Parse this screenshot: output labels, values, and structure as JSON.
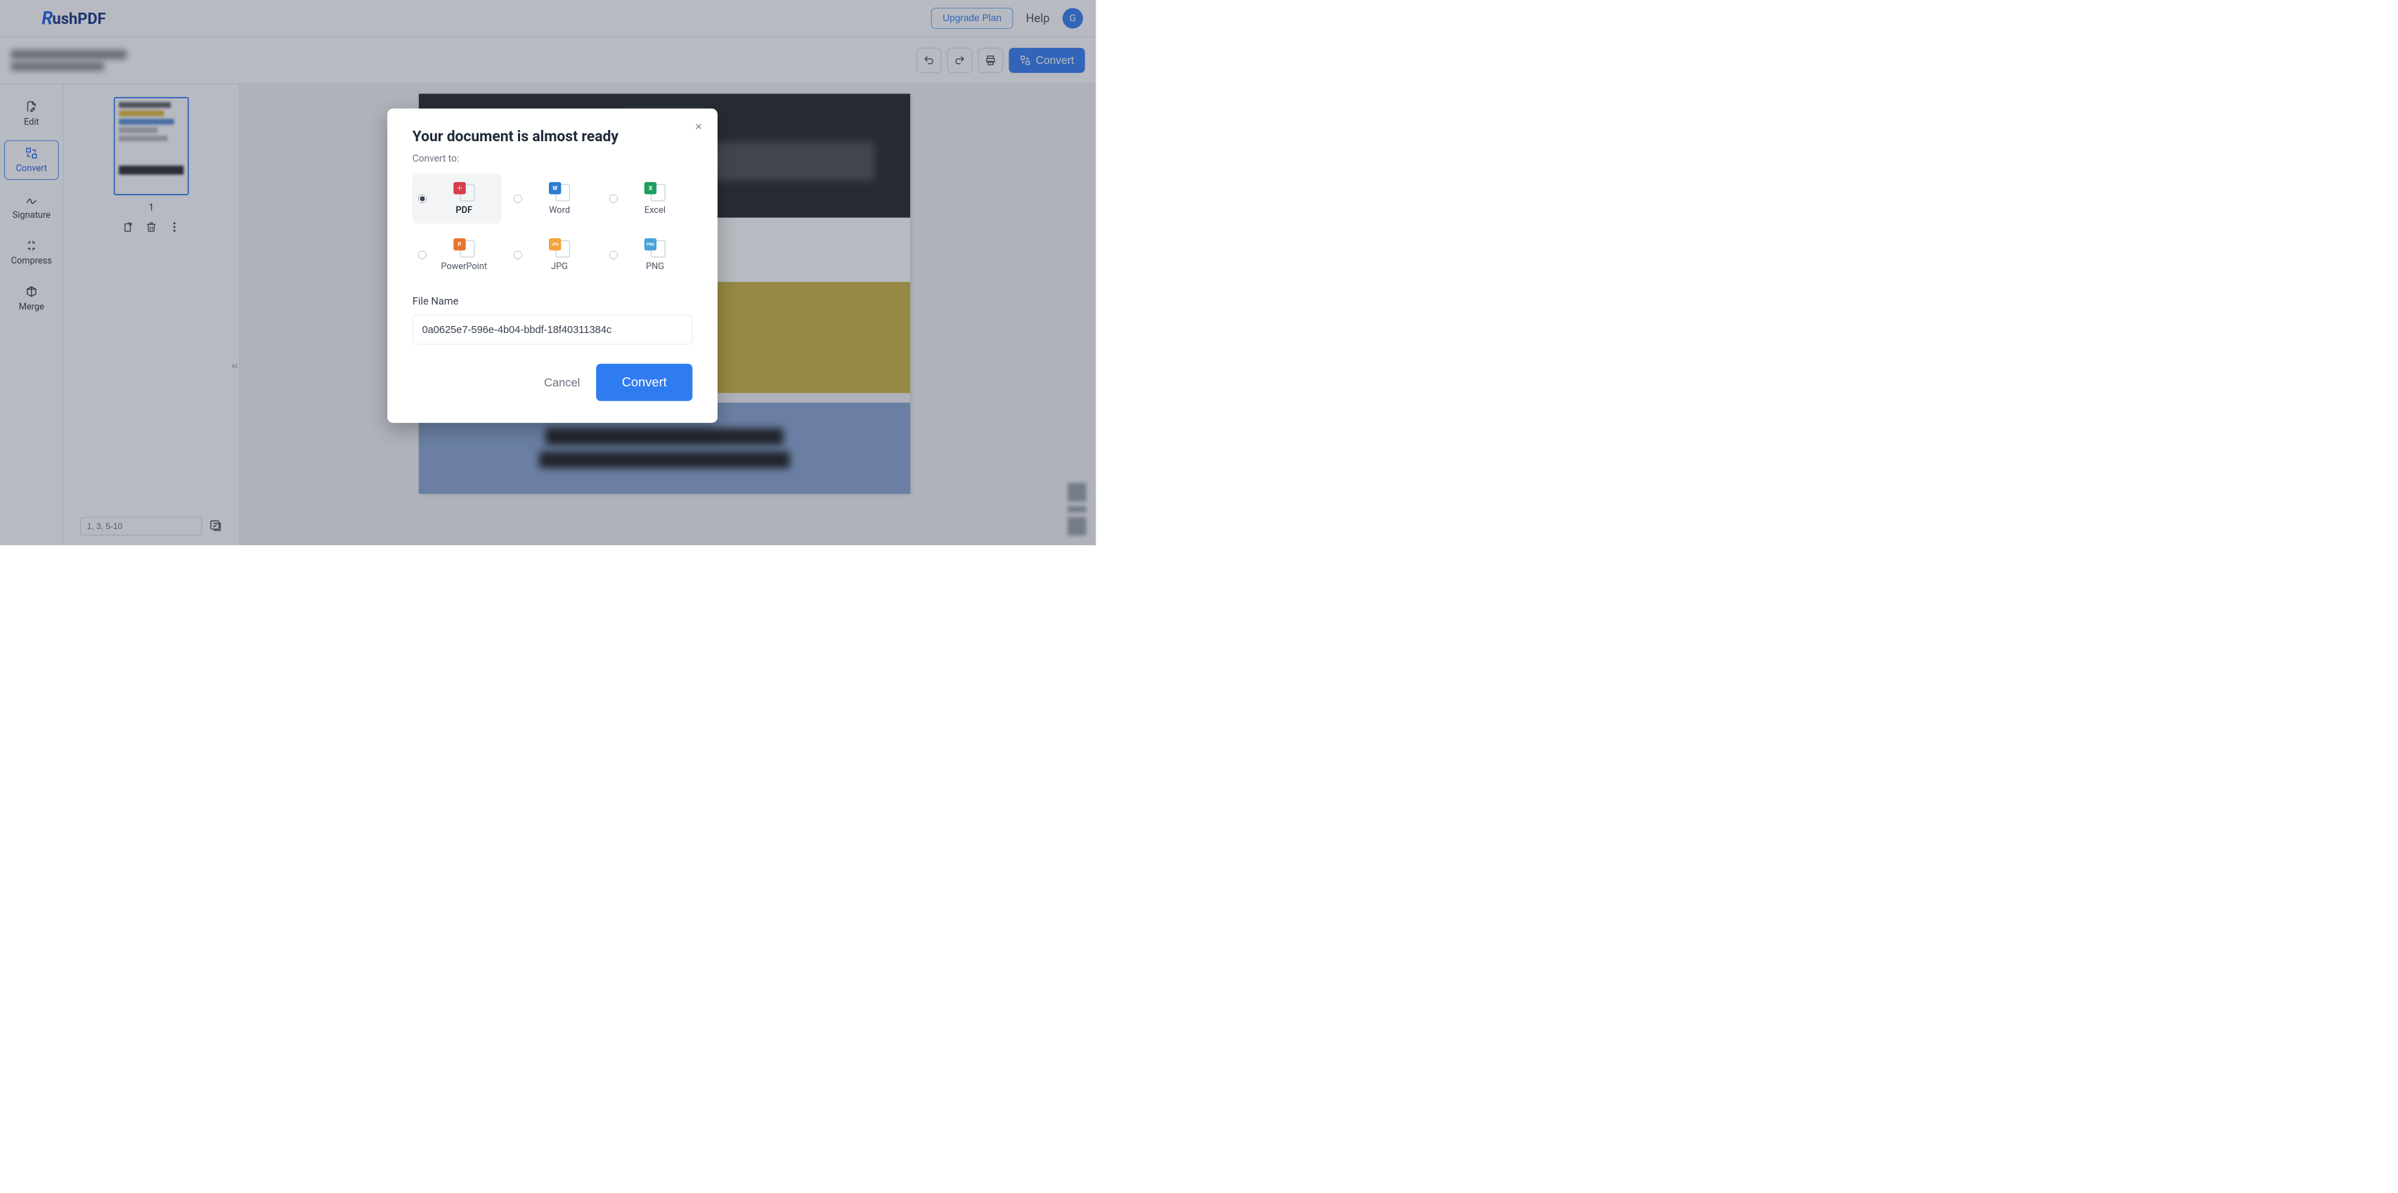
{
  "topbar": {
    "brand_part1": "R",
    "brand_part2": "ushPDF",
    "upgrade_label": "Upgrade Plan",
    "help_label": "Help",
    "avatar_initial": "G"
  },
  "toolbar": {
    "convert_label": "Convert"
  },
  "sidebar": {
    "items": [
      {
        "id": "edit",
        "label": "Edit"
      },
      {
        "id": "convert",
        "label": "Convert"
      },
      {
        "id": "signature",
        "label": "Signature"
      },
      {
        "id": "compress",
        "label": "Compress"
      },
      {
        "id": "merge",
        "label": "Merge"
      }
    ]
  },
  "thumbs": {
    "page_number": "1",
    "page_input_placeholder": "1, 3, 5-10"
  },
  "modal": {
    "title": "Your document is almost ready",
    "subtitle": "Convert to:",
    "formats": [
      {
        "id": "pdf",
        "label": "PDF",
        "badge": "",
        "color": "#d63d4b",
        "selected": true
      },
      {
        "id": "word",
        "label": "Word",
        "badge": "W",
        "color": "#2b7cd3",
        "selected": false
      },
      {
        "id": "excel",
        "label": "Excel",
        "badge": "X",
        "color": "#1f9e5f",
        "selected": false
      },
      {
        "id": "powerpoint",
        "label": "PowerPoint",
        "badge": "P",
        "color": "#e8742e",
        "selected": false
      },
      {
        "id": "jpg",
        "label": "JPG",
        "badge": "JPG",
        "color": "#f2a33c",
        "selected": false
      },
      {
        "id": "png",
        "label": "PNG",
        "badge": "PNG",
        "color": "#4aa0d8",
        "selected": false
      }
    ],
    "filename_label": "File Name",
    "filename_value": "0a0625e7-596e-4b04-bbdf-18f40311384c",
    "cancel_label": "Cancel",
    "convert_label": "Convert"
  }
}
